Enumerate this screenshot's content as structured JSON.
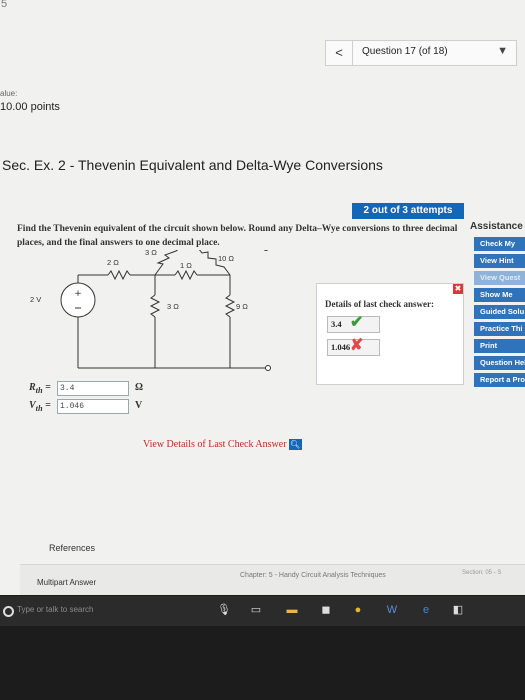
{
  "corner_digit": "5",
  "question_nav": {
    "prev_symbol": "<",
    "label": "Question 17 (of 18)",
    "caret": "▼"
  },
  "value_label": "alue:",
  "points": "10.00 points",
  "section_title": "Sec. Ex. 2 - Thevenin Equivalent and Delta-Wye Conversions",
  "attempts": "2 out of 3 attempts",
  "problem_text": "Find the Thevenin equivalent of the circuit shown below. Round any Delta–Wye conversions to three decimal places, and the final answers to one decimal place.",
  "assistance": {
    "title": "Assistance",
    "buttons": [
      "Check My",
      "View Hint",
      "View Quest",
      "Show Me",
      "Guided Solu",
      "Practice Thi",
      "Print",
      "Question Hel",
      "Report a Prob"
    ]
  },
  "circuit": {
    "source_label": "2 V",
    "source_sign": "+",
    "resistors": {
      "r2": "2 Ω",
      "r3_top": "3 Ω",
      "r10": "10 Ω",
      "r1": "1 Ω",
      "r3_mid": "3 Ω",
      "r9": "9 Ω"
    }
  },
  "details": {
    "title": "Details of last check answer:",
    "answers": [
      {
        "value": "3.4",
        "status": "correct"
      },
      {
        "value": "1.046",
        "status": "incorrect"
      }
    ],
    "close_symbol": "✖"
  },
  "fields": [
    {
      "var": "R",
      "sub": "th",
      "value": "3.4",
      "unit": "Ω"
    },
    {
      "var": "V",
      "sub": "th",
      "value": "1.046",
      "unit": "V"
    }
  ],
  "view_details_link": "View Details of Last Check Answer",
  "references": "References",
  "multipart": "Multipart Answer",
  "chapter": "Chapter: 5 - Handy Circuit Analysis Techniques",
  "section_num": "Section: 05 - S",
  "taskbar_search": "Type or talk to search",
  "colors": {
    "accent": "#1466b8",
    "correct": "#3a9b3d",
    "incorrect": "#e0484a",
    "link": "#c62828"
  }
}
